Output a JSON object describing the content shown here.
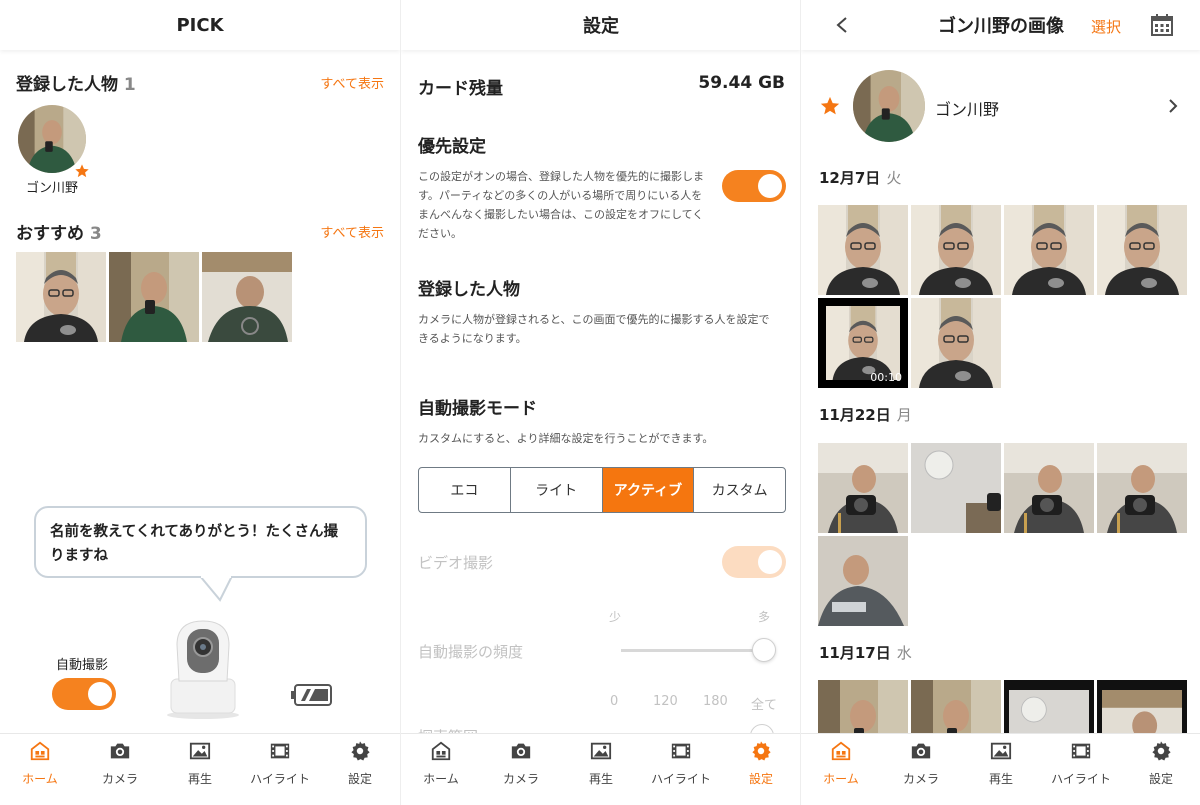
{
  "screen1": {
    "title": "PICK",
    "registered": {
      "label": "登録した人物",
      "count": "1",
      "see_all": "すべて表示",
      "person_name": "ゴン川野"
    },
    "recommend": {
      "label": "おすすめ",
      "count": "3",
      "see_all": "すべて表示"
    },
    "bubble_text": "名前を教えてくれてありがとう！たくさん撮りますね",
    "auto_shoot_label": "自動撮影"
  },
  "screen2": {
    "title": "設定",
    "card_label": "カード残量",
    "card_value": "59.44 GB",
    "priority_title": "優先設定",
    "priority_desc": "この設定がオンの場合、登録した人物を優先的に撮影します。パーティなどの多くの人がいる場所で周りにいる人をまんべんなく撮影したい場合は、この設定をオフにしてください。",
    "registered_title": "登録した人物",
    "registered_desc": "カメラに人物が登録されると、この画面で優先的に撮影する人を設定できるようになります。",
    "mode_title": "自動撮影モード",
    "mode_desc": "カスタムにすると、より詳細な設定を行うことができます。",
    "modes": [
      "エコ",
      "ライト",
      "アクティブ",
      "カスタム"
    ],
    "video_label": "ビデオ撮影",
    "freq_min": "少",
    "freq_max": "多",
    "freq_label": "自動撮影の頻度",
    "freq_level": 1.0,
    "range_ticks": [
      "0",
      "120",
      "180",
      "全て"
    ],
    "search_label": "探索範囲"
  },
  "screen3": {
    "title": "ゴン川野の画像",
    "select_label": "選択",
    "person_name": "ゴン川野",
    "groups": [
      {
        "date": "12月7日",
        "dow": "火"
      },
      {
        "date": "11月22日",
        "dow": "月"
      },
      {
        "date": "11月17日",
        "dow": "水"
      }
    ],
    "video_duration": "00:10"
  },
  "tabs": [
    "ホーム",
    "カメラ",
    "再生",
    "ハイライト",
    "設定"
  ],
  "colors": {
    "accent": "#f57612",
    "toggle_disabled": "#fcdcc1"
  }
}
